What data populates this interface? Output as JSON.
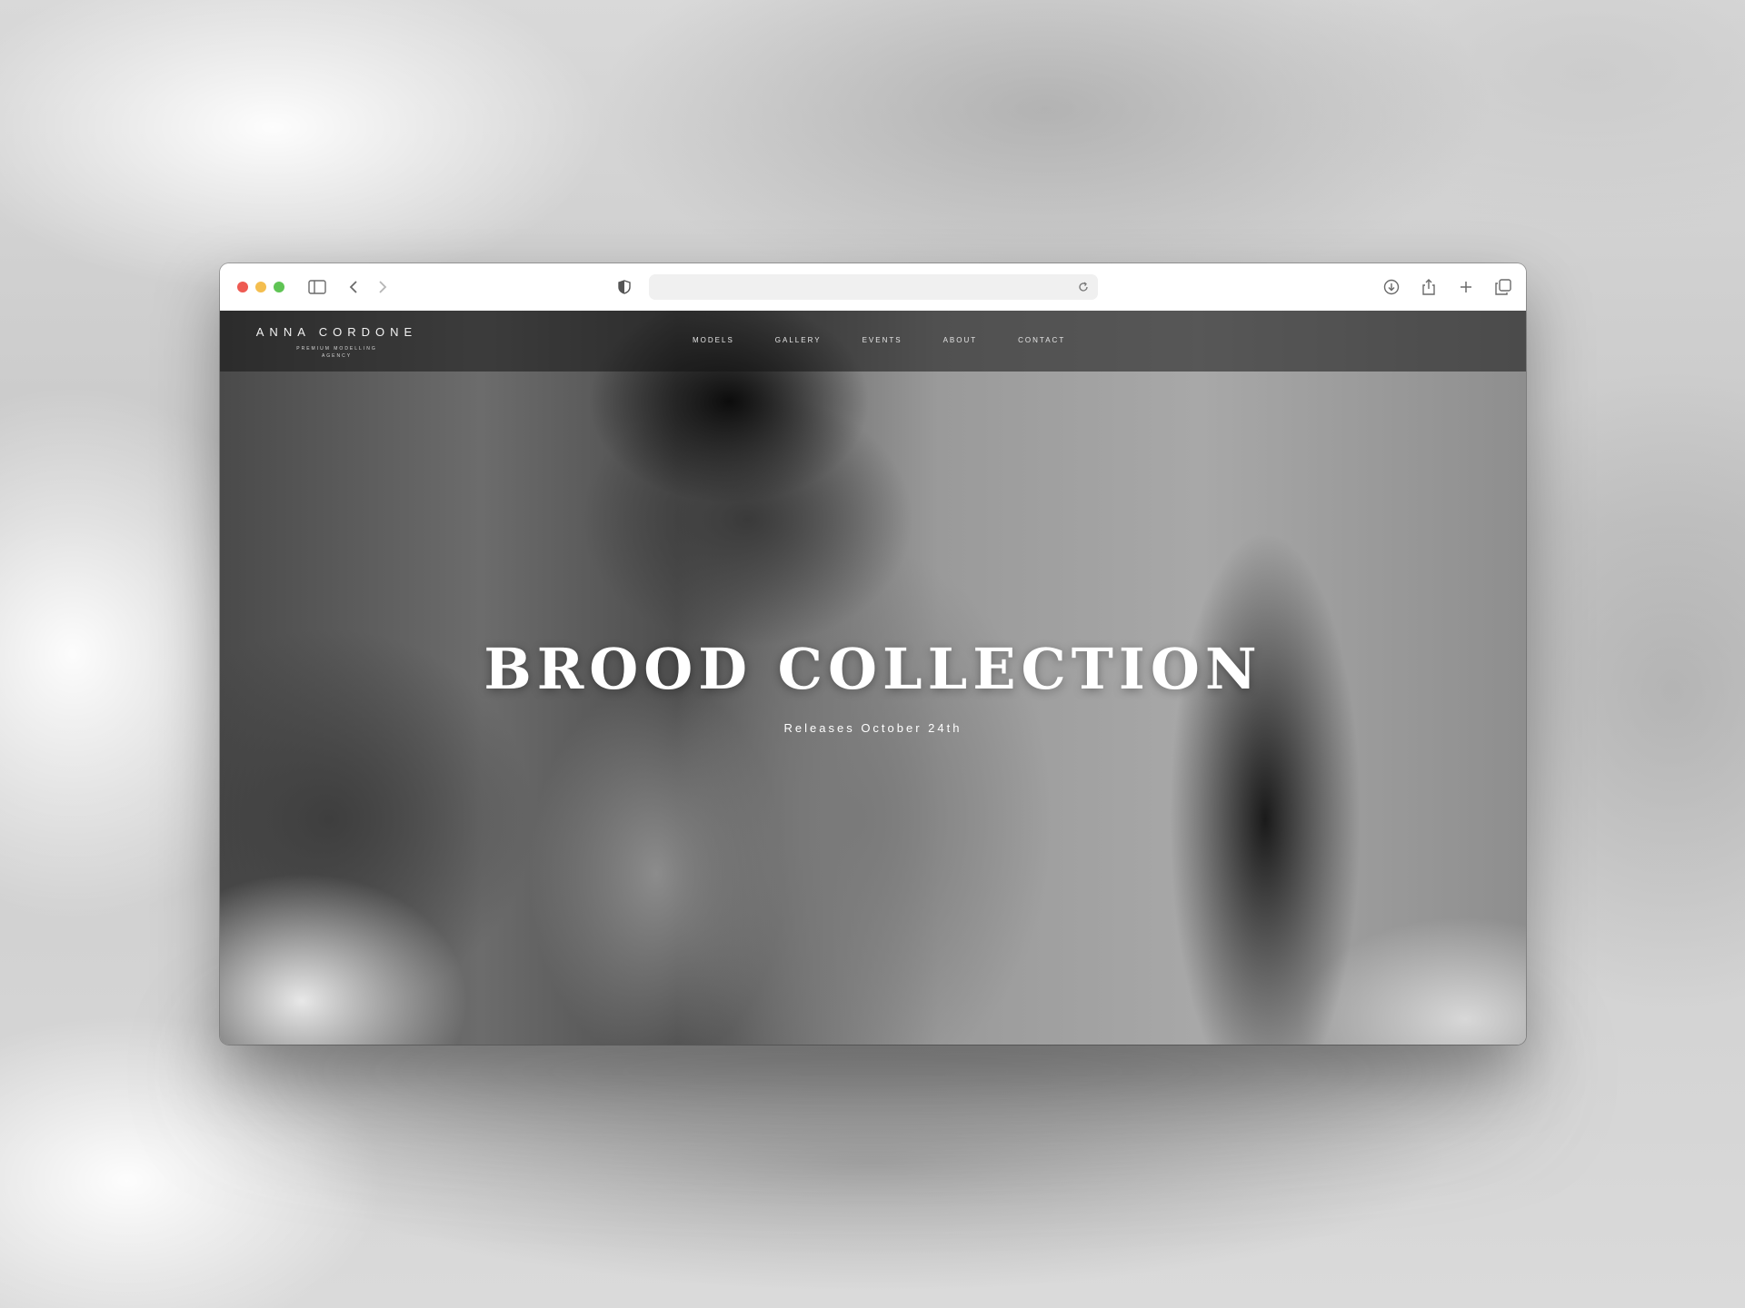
{
  "browser": {
    "icons": {
      "sidebar": "sidebar-icon",
      "back": "chevron-left-icon",
      "forward": "chevron-right-icon",
      "shield": "shield-icon",
      "reload": "reload-icon",
      "download": "download-icon",
      "share": "share-icon",
      "new_tab": "plus-icon",
      "tabs": "tab-overview-icon"
    },
    "traffic_lights": [
      "#ee5a52",
      "#f4be4f",
      "#5fc454"
    ]
  },
  "site": {
    "brand": "ANNA CORDONE",
    "tagline": "PREMIUM MODELLING AGENCY",
    "nav": [
      "MODELS",
      "GALLERY",
      "EVENTS",
      "ABOUT",
      "CONTACT"
    ],
    "hero": {
      "title": "BROOD COLLECTION",
      "subtitle": "Releases October 24th"
    }
  }
}
